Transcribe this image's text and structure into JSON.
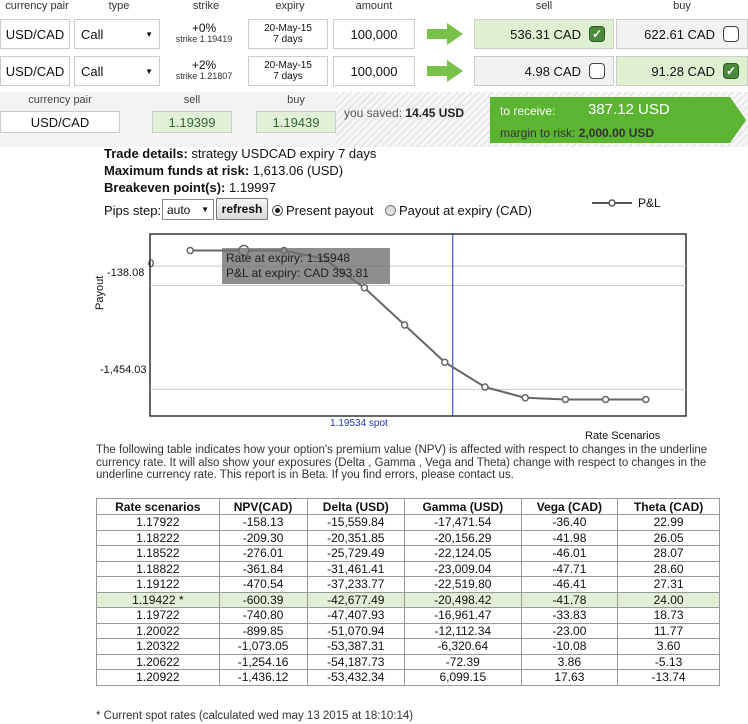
{
  "header": {
    "currency_pair": "currency pair",
    "type": "type",
    "strike": "strike",
    "expiry": "expiry",
    "amount": "amount",
    "sell": "sell",
    "buy": "buy"
  },
  "options": [
    {
      "pair": "USD/CAD",
      "type": "Call",
      "strike_pct": "+0%",
      "strike_val": "strike 1.19419",
      "expiry_date": "20-May-15",
      "expiry_days": "7 days",
      "amount": "100,000",
      "sell": "536.31 CAD",
      "sell_checked": true,
      "buy": "622.61 CAD",
      "buy_checked": false
    },
    {
      "pair": "USD/CAD",
      "type": "Call",
      "strike_pct": "+2%",
      "strike_val": "strike 1.21807",
      "expiry_date": "20-May-15",
      "expiry_days": "7 days",
      "amount": "100,000",
      "sell": "4.98 CAD",
      "sell_checked": false,
      "buy": "91.28 CAD",
      "buy_checked": true
    }
  ],
  "summary": {
    "pair_label": "currency pair",
    "pair": "USD/CAD",
    "sell_label": "sell",
    "sell_rate": "1.19399",
    "buy_label": "buy",
    "buy_rate": "1.19439",
    "saved_label": "you saved:",
    "saved_value": "14.45 USD",
    "receive_label": "to receive:",
    "receive_value": "387.12 USD",
    "margin_label": "margin to risk:",
    "margin_value": "2,000.00 USD"
  },
  "details": {
    "trade_label": "Trade details:",
    "trade_value": " strategy USDCAD expiry 7 days",
    "funds_label": "Maximum funds at risk:",
    "funds_value": " 1,613.06 (USD)",
    "breakeven_label": "Breakeven point(s):",
    "breakeven_value": " 1.19997"
  },
  "controls": {
    "pips_label": "Pips step:",
    "pips_value": "auto",
    "refresh_label": "refresh",
    "radio1_label": "Present payout",
    "radio2_label": "Payout at expiry (CAD)",
    "legend_label": "P&L"
  },
  "chart_data": {
    "type": "line",
    "series": [
      {
        "name": "P&L",
        "values": [
          200,
          200,
          200,
          100,
          -250,
          -700,
          -1150,
          -1450,
          -1580,
          -1600,
          -1600,
          -1600
        ]
      }
    ],
    "x": [
      1.175,
      1.179,
      1.182,
      1.185,
      1.188,
      1.191,
      1.194,
      1.197,
      1.2,
      1.203,
      1.206,
      1.209
    ],
    "ylabel": "Payout",
    "xlabel": "Rate Scenarios",
    "ytick_labels": [
      "-138.08",
      "-1,454.03",
      "0"
    ],
    "spot_label": "1.19534 spot",
    "tooltip_line1": "Rate at expiry: 1.15948",
    "tooltip_line2": "P&L at expiry: CAD 393.81"
  },
  "paragraph": "The following table indicates how your option's premium value (NPV) is affected with respect to changes in the underline currency rate. It will also show your exposures (Delta , Gamma , Vega and Theta) change with respect to changes in the underline currency rate. This report is in Beta. If you find errors, please contact us.",
  "table": {
    "headers": [
      "Rate scenarios",
      "NPV(CAD)",
      "Delta (USD)",
      "Gamma (USD)",
      "Vega (CAD)",
      "Theta (CAD)"
    ],
    "rows": [
      [
        "1.17922",
        "-158.13",
        "-15,559.84",
        "-17,471.54",
        "-36.40",
        "22.99"
      ],
      [
        "1.18222",
        "-209.30",
        "-20,351.85",
        "-20,156.29",
        "-41.98",
        "26.05"
      ],
      [
        "1.18522",
        "-276.01",
        "-25,729.49",
        "-22,124.05",
        "-46.01",
        "28.07"
      ],
      [
        "1.18822",
        "-361.84",
        "-31,461.41",
        "-23,009.04",
        "-47.71",
        "28.60"
      ],
      [
        "1.19122",
        "-470.54",
        "-37,233.77",
        "-22,519.80",
        "-46.41",
        "27.31"
      ],
      [
        "1.19422 *",
        "-600.39",
        "-42,677.49",
        "-20,498.42",
        "-41.78",
        "24.00"
      ],
      [
        "1.19722",
        "-740.80",
        "-47,407.93",
        "-16,961.47",
        "-33.83",
        "18.73"
      ],
      [
        "1.20022",
        "-899.85",
        "-51,070.94",
        "-12,112.34",
        "-23.00",
        "11.77"
      ],
      [
        "1.20322",
        "-1,073.05",
        "-53,387.31",
        "-6,320.64",
        "-10.08",
        "3.60"
      ],
      [
        "1.20622",
        "-1,254.16",
        "-54,187.73",
        "-72.39",
        "3.86",
        "-5.13"
      ],
      [
        "1.20922",
        "-1,436.12",
        "-53,432.34",
        "6,099.15",
        "17.63",
        "-13.74"
      ]
    ]
  },
  "footnote": "* Current spot rates (calculated wed may 13 2015 at 18:10:14)"
}
